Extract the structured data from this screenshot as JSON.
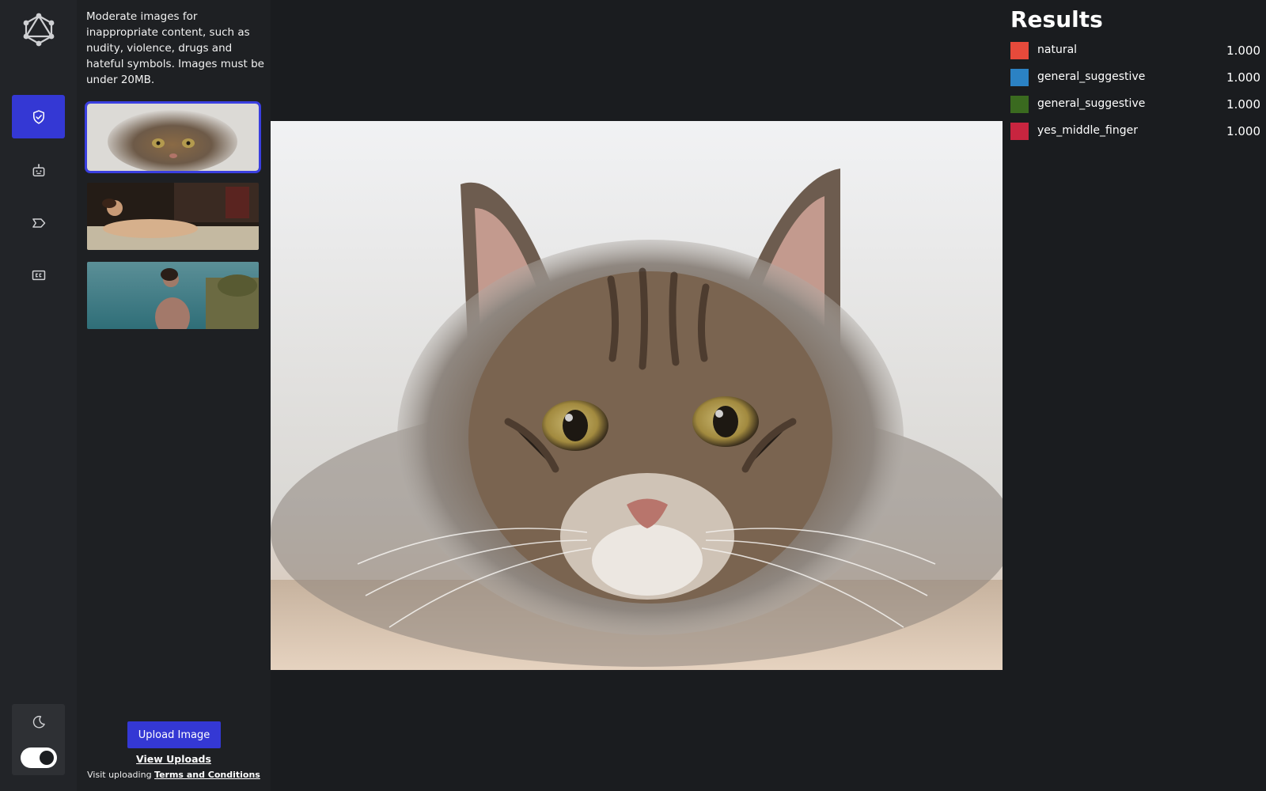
{
  "sidebar": {
    "nav": [
      {
        "icon": "shield-check-icon",
        "active": true
      },
      {
        "icon": "robot-icon",
        "active": false
      },
      {
        "icon": "tag-icon",
        "active": false
      },
      {
        "icon": "closed-caption-icon",
        "active": false
      }
    ],
    "theme": {
      "icon": "moon-icon",
      "dark_mode": true
    }
  },
  "examples": {
    "description": "Moderate images for inappropriate content, such as nudity, violence, drugs and hateful symbols. Images must be under 20MB.",
    "thumbnails": [
      {
        "subject": "tabby cat",
        "selected": true
      },
      {
        "subject": "reclining figure painting",
        "selected": false
      },
      {
        "subject": "person by the sea",
        "selected": false
      }
    ],
    "upload_label": "Upload Image",
    "view_uploads_label": "View Uploads",
    "terms_prefix": "Visit uploading ",
    "terms_link": "Terms and Conditions"
  },
  "results": {
    "title": "Results",
    "items": [
      {
        "label": "natural",
        "score": "1.000",
        "color": "#e64a3b"
      },
      {
        "label": "general_suggestive",
        "score": "1.000",
        "color": "#2b82c4"
      },
      {
        "label": "general_suggestive",
        "score": "1.000",
        "color": "#3a6a1f"
      },
      {
        "label": "yes_middle_finger",
        "score": "1.000",
        "color": "#c8253f"
      }
    ]
  },
  "colors": {
    "accent": "#3438d4",
    "background": "#1a1c1f",
    "rail": "#222428"
  }
}
